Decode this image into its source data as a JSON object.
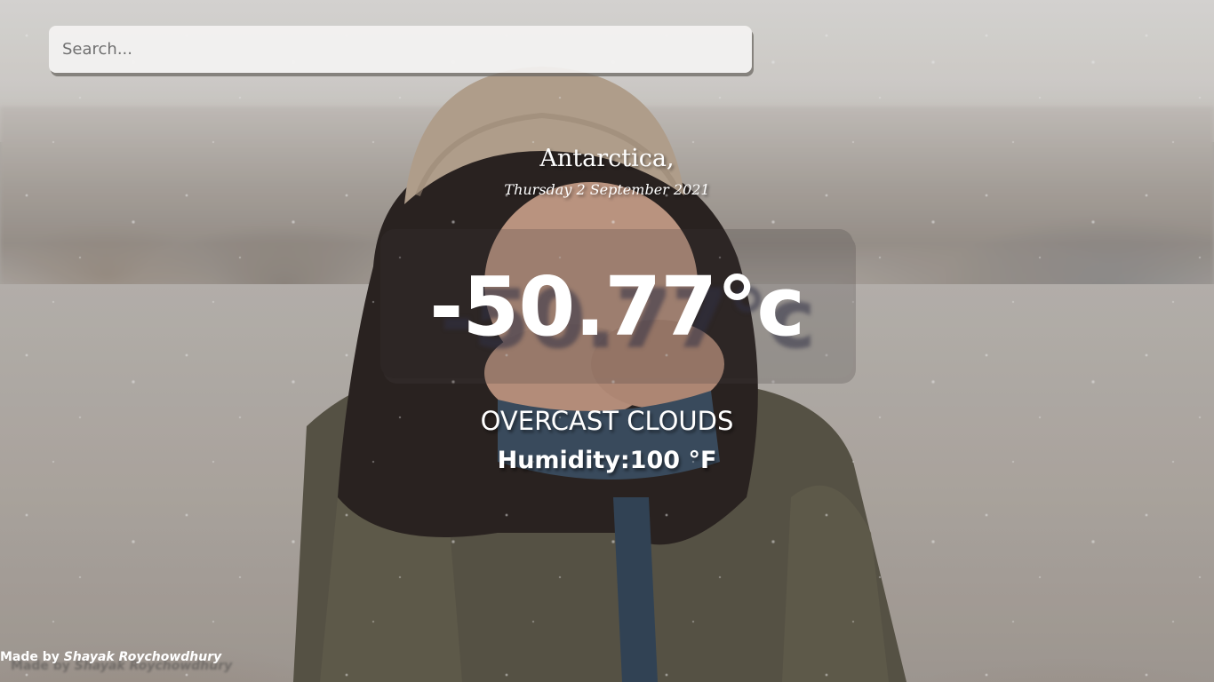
{
  "search": {
    "placeholder": "Search...",
    "value": ""
  },
  "weather": {
    "location": "Antarctica,",
    "date": "Thursday 2 September 2021",
    "temperature": "-50.77°c",
    "condition": "OVERCAST CLOUDS",
    "humidity": "Humidity:100 °F"
  },
  "footer": {
    "prefix": "Made by",
    "author": "Shayak Roychowdhury"
  },
  "colors": {
    "text": "#ffffff",
    "search_bg": "#f4f3f2",
    "temp_box": "#3c3737"
  },
  "background": {
    "icon": "snowy-portrait-photo"
  }
}
